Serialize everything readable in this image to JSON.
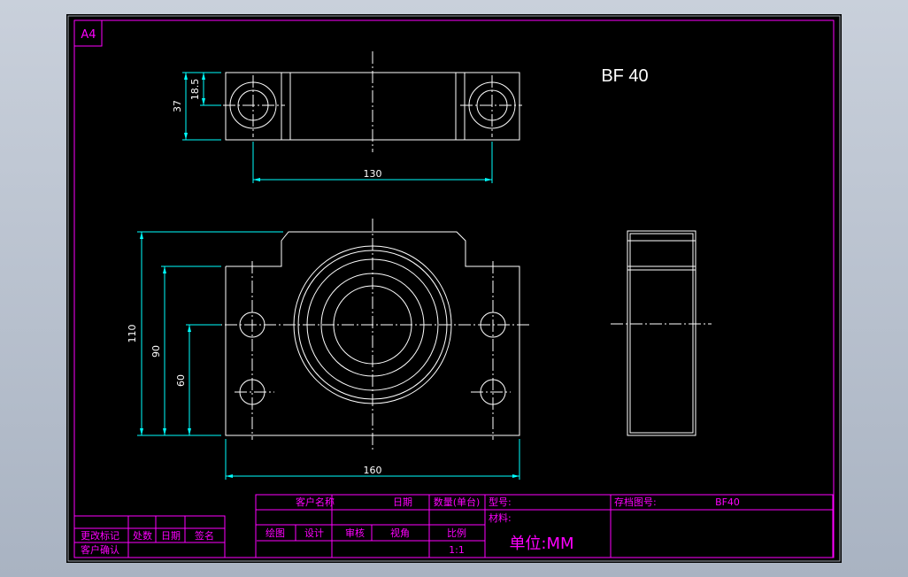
{
  "sheet": {
    "size_label": "A4",
    "part_title": "BF 40"
  },
  "colors": {
    "background": "#000000",
    "border": "#ff00ff",
    "geometry": "#ffffff",
    "dimension": "#00ffff",
    "text": "#ffffff",
    "title_text": "#ff00ff",
    "window": "#b4bdca"
  },
  "dimensions": {
    "height_small": "18.5",
    "height_top": "37",
    "hole_spacing": "130",
    "overall_height": "110",
    "center_height": "90",
    "base_height": "60",
    "overall_width": "160"
  },
  "title_block": {
    "customer_name": "客户名称",
    "date": "日期",
    "quantity": "数量(单台)",
    "model_no": "型号:",
    "drawing_no_label": "存档图号:",
    "drawing_no_value": "BF40",
    "material": "材料:",
    "drawn": "绘图",
    "design": "设计",
    "check": "审核",
    "view": "视角",
    "scale_label": "比例",
    "scale_value": "1:1",
    "unit": "单位:MM"
  },
  "revision_block": {
    "change_mark": "更改标记",
    "count": "处数",
    "date": "日期",
    "signature": "签名",
    "customer_confirm": "客户确认"
  }
}
